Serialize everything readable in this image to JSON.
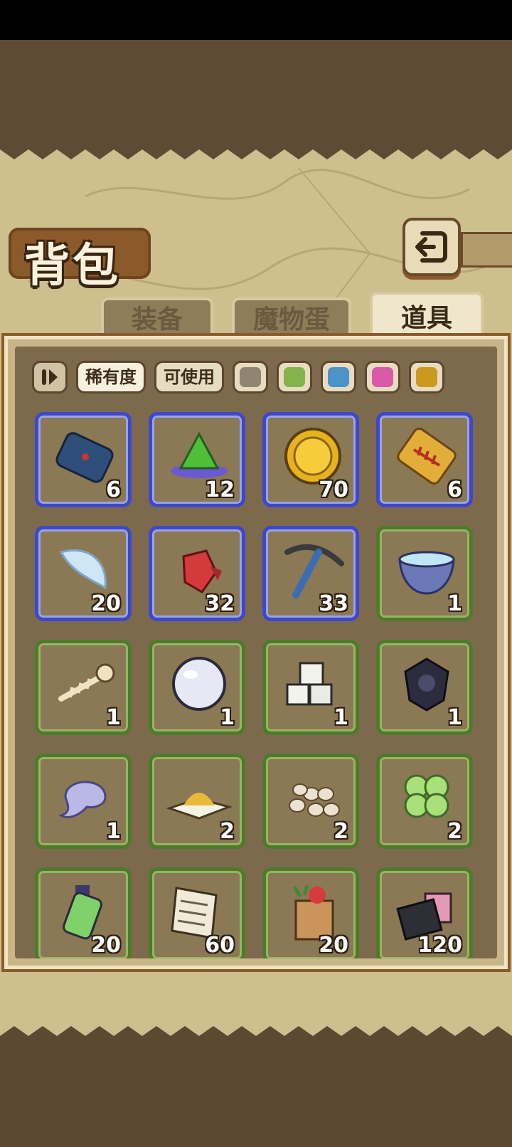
{
  "title": "背包",
  "tabs": [
    {
      "label": "装备",
      "active": false
    },
    {
      "label": "魔物蛋",
      "active": false
    },
    {
      "label": "道具",
      "active": true
    }
  ],
  "filters": {
    "sort_icon": "sort-toggle-icon",
    "rarity_label": "稀有度",
    "usable_label": "可使用",
    "colors": [
      "#8f8672",
      "#86b24c",
      "#4c93c9",
      "#d85aa8",
      "#c99a1e"
    ]
  },
  "colors": {
    "blue_rarity": "#3e48c9",
    "green_rarity": "#4e7b2b"
  },
  "items": [
    {
      "icon": "blue-pouch-icon",
      "qty": "6",
      "rarity": "blue"
    },
    {
      "icon": "green-crystal-icon",
      "qty": "12",
      "rarity": "blue"
    },
    {
      "icon": "gold-coin-icon",
      "qty": "70",
      "rarity": "blue"
    },
    {
      "icon": "fish-bone-tag-icon",
      "qty": "6",
      "rarity": "blue"
    },
    {
      "icon": "fairy-wing-icon",
      "qty": "20",
      "rarity": "blue"
    },
    {
      "icon": "red-ore-icon",
      "qty": "32",
      "rarity": "blue"
    },
    {
      "icon": "pickaxe-icon",
      "qty": "33",
      "rarity": "blue"
    },
    {
      "icon": "water-bowl-icon",
      "qty": "1",
      "rarity": "green"
    },
    {
      "icon": "skeleton-icon",
      "qty": "1",
      "rarity": "green"
    },
    {
      "icon": "pearl-icon",
      "qty": "1",
      "rarity": "green"
    },
    {
      "icon": "sugar-cubes-icon",
      "qty": "1",
      "rarity": "green"
    },
    {
      "icon": "dark-emblem-icon",
      "qty": "1",
      "rarity": "green"
    },
    {
      "icon": "ghost-slime-icon",
      "qty": "1",
      "rarity": "green"
    },
    {
      "icon": "sand-pile-icon",
      "qty": "2",
      "rarity": "green"
    },
    {
      "icon": "beans-icon",
      "qty": "2",
      "rarity": "green"
    },
    {
      "icon": "clover-icon",
      "qty": "2",
      "rarity": "green"
    },
    {
      "icon": "potion-bottle-icon",
      "qty": "20",
      "rarity": "green"
    },
    {
      "icon": "scroll-paper-icon",
      "qty": "60",
      "rarity": "green"
    },
    {
      "icon": "grocery-bag-icon",
      "qty": "20",
      "rarity": "green"
    },
    {
      "icon": "cloth-bundle-icon",
      "qty": "120",
      "rarity": "green"
    }
  ]
}
